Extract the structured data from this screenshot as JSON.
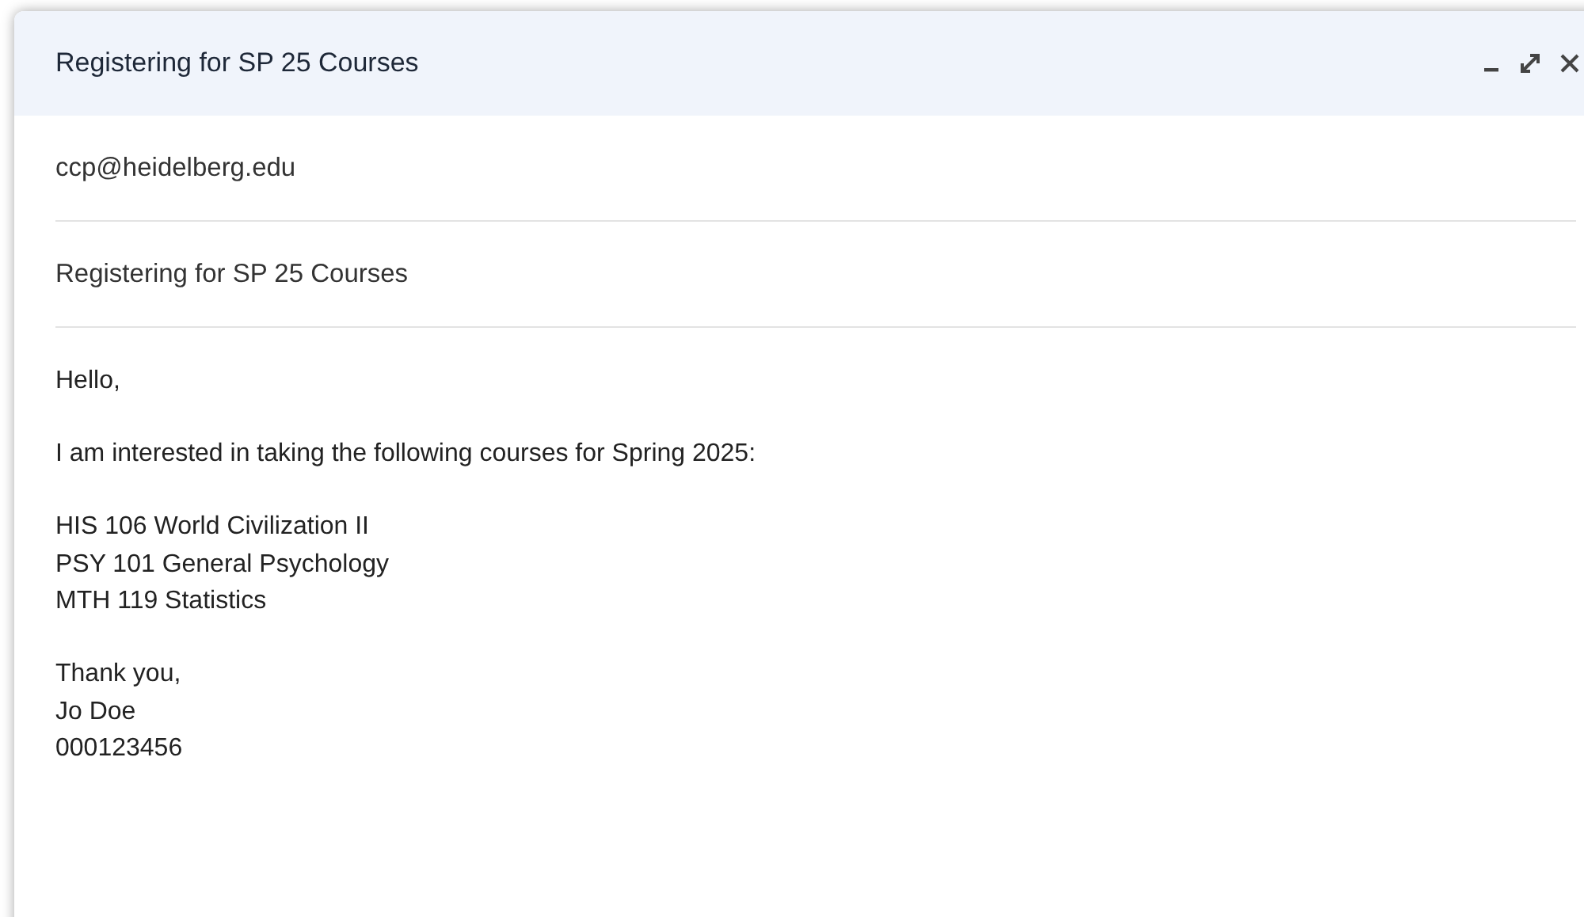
{
  "window": {
    "title": "Registering for SP 25 Courses"
  },
  "to": {
    "value": "ccp@heidelberg.edu"
  },
  "subject": {
    "value": "Registering for SP 25 Courses"
  },
  "body": {
    "paragraphs": [
      [
        "Hello,"
      ],
      [
        "I am interested in taking the following courses for Spring 2025:"
      ],
      [
        "HIS 106 World Civilization II",
        "PSY 101 General Psychology",
        "MTH 119 Statistics"
      ],
      [
        "Thank you,",
        "Jo Doe",
        "000123456"
      ]
    ]
  }
}
